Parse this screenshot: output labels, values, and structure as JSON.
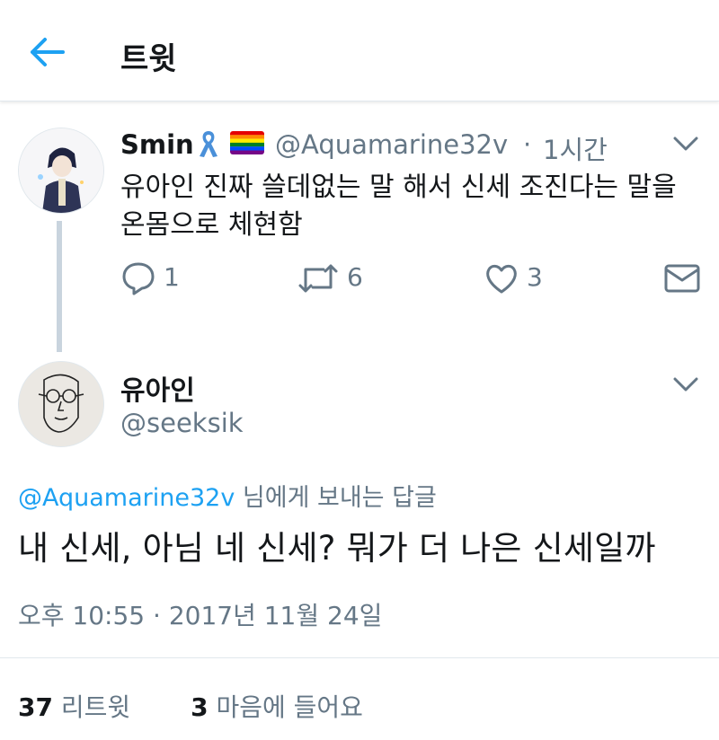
{
  "header": {
    "title": "트윗"
  },
  "parent_tweet": {
    "name": "Smin",
    "handle": "@Aquamarine32v",
    "separator": "·",
    "time": "1시간",
    "text": "유아인 진짜 쓸데없는 말 해서 신세 조진다는 말을 온몸으로 체현함",
    "reply_count": "1",
    "retweet_count": "6",
    "like_count": "3"
  },
  "main_tweet": {
    "name": "유아인",
    "handle": "@seeksik",
    "reply_mention": "@Aquamarine32v",
    "reply_suffix": " 님에게 보내는 답글",
    "text": "내 신세, 아님 네 신세? 뭐가 더 나은 신세일까",
    "timestamp": "오후 10:55 · 2017년 11월 24일",
    "retweets_count": "37",
    "retweets_label": "리트윗",
    "likes_count": "3",
    "likes_label": "마음에 들어요"
  },
  "colors": {
    "accent": "#1da1f2",
    "secondary_text": "#657786",
    "thread_line": "#c9d4de"
  },
  "icons": [
    "back-arrow-icon",
    "ribbon-icon",
    "rainbow-flag-icon",
    "chevron-down-icon",
    "reply-icon",
    "retweet-icon",
    "heart-icon",
    "envelope-icon"
  ]
}
